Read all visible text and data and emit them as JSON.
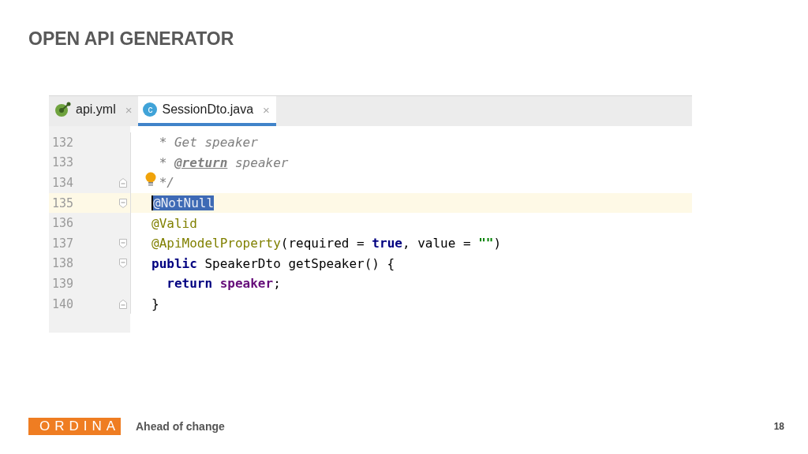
{
  "slide": {
    "title": "OPEN API GENERATOR",
    "tagline": "Ahead of change",
    "page_number": "18",
    "logo": "ORDINA"
  },
  "editor": {
    "tabs": [
      {
        "label": "api.yml",
        "kind": "yaml",
        "close": "×",
        "selected": false
      },
      {
        "label": "SessionDto.java",
        "kind": "class",
        "icon_letter": "c",
        "close": "×",
        "selected": true
      }
    ],
    "lines": [
      {
        "number": "132",
        "current": false,
        "kind": "plain",
        "tokens": [
          {
            "text": " * Get speaker",
            "kind": "comment"
          }
        ]
      },
      {
        "number": "133",
        "current": false,
        "kind": "plain",
        "tokens": [
          {
            "text": " * ",
            "kind": "comment"
          },
          {
            "text": "@return",
            "kind": "doctag"
          },
          {
            "text": " speaker",
            "kind": "comment"
          }
        ]
      },
      {
        "number": "134",
        "current": false,
        "kind": "foldend",
        "bulb": true,
        "tokens": [
          {
            "text": " */",
            "kind": "comment"
          }
        ]
      },
      {
        "number": "135",
        "current": true,
        "kind": "foldstart",
        "tokens": [
          {
            "text": "@NotNull",
            "kind": "selection"
          }
        ]
      },
      {
        "number": "136",
        "current": false,
        "kind": "plain",
        "tokens": [
          {
            "text": "@Valid",
            "kind": "annotation"
          }
        ]
      },
      {
        "number": "137",
        "current": false,
        "kind": "foldstart",
        "tokens": [
          {
            "text": "@ApiModelProperty",
            "kind": "annotation"
          },
          {
            "text": "(required = ",
            "kind": "plain"
          },
          {
            "text": "true",
            "kind": "keyword"
          },
          {
            "text": ", value = ",
            "kind": "plain"
          },
          {
            "text": "\"\"",
            "kind": "string"
          },
          {
            "text": ")",
            "kind": "plain"
          }
        ]
      },
      {
        "number": "138",
        "current": false,
        "kind": "foldstart",
        "tokens": [
          {
            "text": "public",
            "kind": "keyword"
          },
          {
            "text": " SpeakerDto getSpeaker() {",
            "kind": "plain"
          }
        ]
      },
      {
        "number": "139",
        "current": false,
        "kind": "plain",
        "tokens": [
          {
            "text": "  return",
            "kind": "keyword"
          },
          {
            "text": " speaker",
            "kind": "field"
          },
          {
            "text": ";",
            "kind": "plain"
          }
        ]
      },
      {
        "number": "140",
        "current": false,
        "kind": "foldend",
        "tokens": [
          {
            "text": "}",
            "kind": "plain"
          }
        ]
      }
    ]
  }
}
